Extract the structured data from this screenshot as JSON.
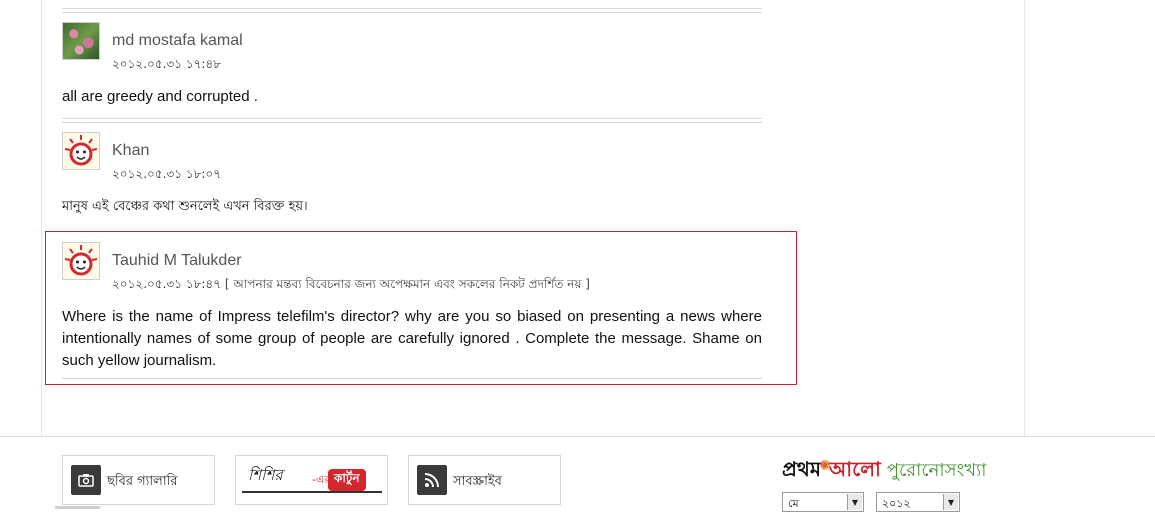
{
  "comments": [
    {
      "author": "md mostafa kamal",
      "timestamp": "২০১২.০৫.৩১ ১৭:৪৮",
      "body": "all are greedy and corrupted .",
      "avatar": "photo-avatar"
    },
    {
      "author": "Khan",
      "timestamp": "২০১২.০৫.৩১ ১৮:০৭",
      "body": "মানুষ এই বেঞ্চের কথা শুনলেই এখন বিরক্ত হয়।",
      "avatar": "mascot-avatar"
    },
    {
      "author": "Tauhid M Talukder",
      "timestamp": "২০১২.০৫.৩১ ১৮:৪৭",
      "pending_note": "[ আপনার মন্তব্য বিবেচনার জন্য অপেক্ষমান এবং সকলের নিকট প্রদর্শিত নয় ]",
      "body": "Where is the name of Impress telefilm's director? why are you so biased on presenting a news where intentionally names of some group of people are carefully ignored . Complete the message. Shame on such yellow journalism.",
      "avatar": "mascot-avatar"
    }
  ],
  "footer": {
    "photo_gallery_label": "ছবির গ্যালারি",
    "cartoon_signature": "শিশির",
    "cartoon_er": "-এর",
    "cartoon_badge": "কার্টুন",
    "subscribe_label": "সাবস্ক্রাইব",
    "brand_part1": "প্রথম",
    "brand_part2": "আলো",
    "brand_archive": "পুরোনোসংখ্যা",
    "month_select": "মে",
    "year_select": "২০১২"
  },
  "colors": {
    "highlight_border": "#c8242b",
    "brand_red": "#c8242b",
    "brand_green": "#3f8f2a"
  },
  "icons": {
    "camera": "camera-icon",
    "rss": "rss-icon",
    "dropdown": "chevron-down-icon"
  }
}
